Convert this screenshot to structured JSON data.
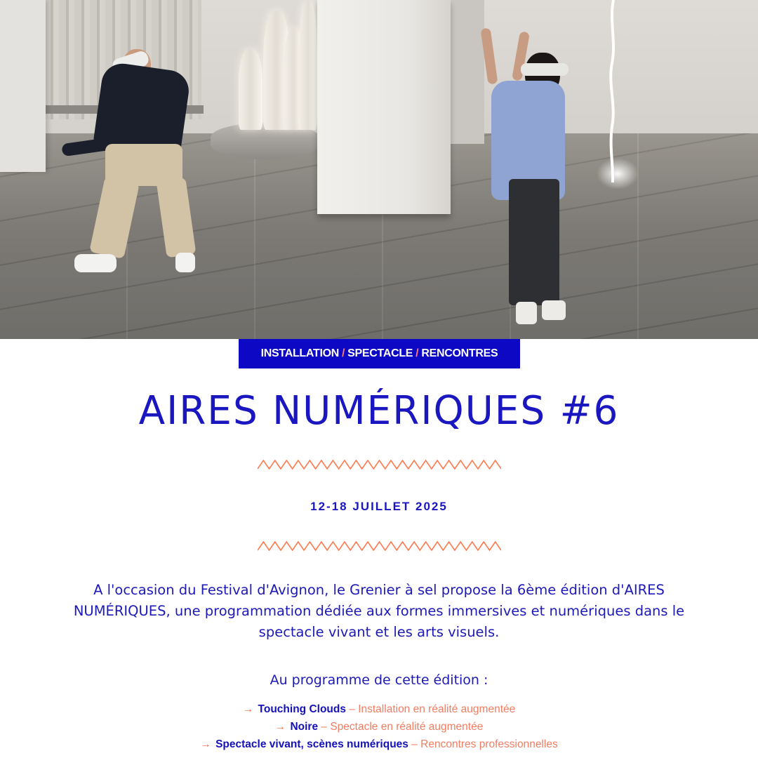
{
  "colors": {
    "brand_blue": "#0c08c4",
    "accent_orange": "#ff6a3d",
    "desc_salmon": "#f07d62",
    "separator_pink": "#ff7a7a"
  },
  "hero": {
    "icon": "photo-of-two-people-with-vr-headsets-in-gallery"
  },
  "categories": [
    "INSTALLATION",
    "SPECTACLE",
    "RENCONTRES"
  ],
  "category_separator": "/",
  "title": "AIRES NUMÉRIQUES #6",
  "date": "12-18 JUILLET 2025",
  "intro": "A l'occasion du Festival d'Avignon, le Grenier à sel propose la 6ème édition d'AIRES NUMÉRIQUES, une programmation dédiée aux formes immersives et numériques dans le spectacle vivant et les arts visuels.",
  "program": {
    "heading": "Au programme de cette édition :",
    "arrow": "→",
    "items": [
      {
        "name": "Touching Clouds",
        "desc": " – Installation en réalité augmentée"
      },
      {
        "name": "Noire",
        "desc": " – Spectacle en réalité augmentée"
      },
      {
        "name": "Spectacle vivant, scènes numériques",
        "desc": " – Rencontres professionnelles"
      }
    ]
  }
}
